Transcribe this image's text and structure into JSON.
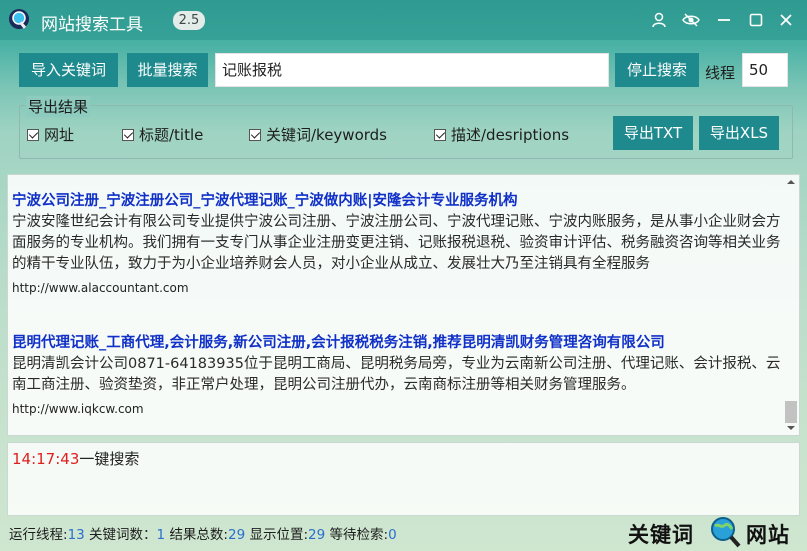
{
  "window": {
    "title": "网站搜索工具",
    "version": "2.5",
    "controls": [
      "user-icon",
      "eye-icon",
      "minimize-icon",
      "maximize-icon",
      "close-icon"
    ]
  },
  "toolbar": {
    "import_label": "导入关键词",
    "batch_label": "批量搜索",
    "keyword_value": "记账报税",
    "stop_label": "停止搜索",
    "threads_label": "线程",
    "threads_value": "50"
  },
  "export": {
    "group_title": "导出结果",
    "options": [
      {
        "label": "网址",
        "checked": true
      },
      {
        "label": "标题/title",
        "checked": true
      },
      {
        "label": "关键词/keywords",
        "checked": true
      },
      {
        "label": "描述/desriptions",
        "checked": true
      }
    ],
    "txt_label": "导出TXT",
    "xls_label": "导出XLS"
  },
  "results": [
    {
      "title": "宁波公司注册_宁波注册公司_宁波代理记账_宁波做内账|安隆会计专业服务机构",
      "description": "宁波安隆世纪会计有限公司专业提供宁波公司注册、宁波注册公司、宁波代理记账、宁波内账服务，是从事小企业财会方面服务的专业机构。我们拥有一支专门从事企业注册变更注销、记账报税退税、验资审计评估、税务融资咨询等相关业务的精干专业队伍，致力于为小企业培养财会人员，对小企业从成立、发展壮大乃至注销具有全程服务",
      "url": "http://www.alaccountant.com"
    },
    {
      "title": "昆明代理记账_工商代理,会计服务,新公司注册,会计报税税务注销,推荐昆明清凯财务管理咨询有限公司",
      "description": "昆明清凯会计公司0871-64183935位于昆明工商局、昆明税务局旁，专业为云南新公司注册、代理记账、会计报税、云南工商注册、验资垫资，非正常户处理，昆明公司注册代办，云南商标注册等相关财务管理服务。",
      "url": "http://www.iqkcw.com"
    }
  ],
  "log": {
    "time": "14:17:43",
    "message": "一键搜索"
  },
  "status": {
    "threads_label": "运行线程:",
    "threads": "13",
    "keywords_label": "关键词数：",
    "keywords": "1",
    "total_label": "结果总数:",
    "total": "29",
    "position_label": "显示位置:",
    "position": "29",
    "pending_label": "等待检索:",
    "pending": "0"
  },
  "brand": {
    "left": "关键词",
    "right": "网站"
  },
  "colors": {
    "accent": "#1f8a8e",
    "titlebar": "#2f9a91",
    "result_title": "#1030c8",
    "log_time": "#e02020",
    "status_number": "#2a6fd0"
  }
}
